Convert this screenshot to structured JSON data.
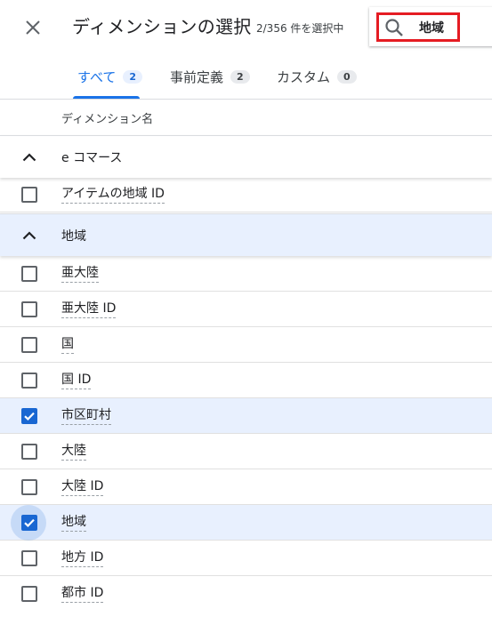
{
  "dialog": {
    "title": "ディメンションの選択",
    "selection_count": "2/356 件を選択中"
  },
  "search": {
    "value": "地域"
  },
  "tabs": [
    {
      "label": "すべて",
      "count": "2",
      "active": true
    },
    {
      "label": "事前定義",
      "count": "2",
      "active": false
    },
    {
      "label": "カスタム",
      "count": "0",
      "active": false
    }
  ],
  "column_header": "ディメンション名",
  "groups": [
    {
      "label": "e コマース",
      "expanded": true,
      "selected": false
    },
    {
      "label": "地域",
      "expanded": true,
      "selected": true
    }
  ],
  "ecommerce_items": [
    {
      "label": "アイテムの地域 ID",
      "checked": false
    }
  ],
  "region_items": [
    {
      "label": "亜大陸",
      "checked": false
    },
    {
      "label": "亜大陸 ID",
      "checked": false
    },
    {
      "label": "国",
      "checked": false
    },
    {
      "label": "国 ID",
      "checked": false
    },
    {
      "label": "市区町村",
      "checked": true
    },
    {
      "label": "大陸",
      "checked": false
    },
    {
      "label": "大陸 ID",
      "checked": false
    },
    {
      "label": "地域",
      "checked": true
    },
    {
      "label": "地方 ID",
      "checked": false
    },
    {
      "label": "都市 ID",
      "checked": false
    }
  ],
  "colors": {
    "accent": "#1a73e8",
    "checkbox_checked": "#1967d2",
    "selected_row": "#e8f0fe",
    "highlight_box": "#e51c23"
  },
  "icons": {
    "close": "close-icon",
    "search": "search-icon",
    "collapse": "chevron-up-icon",
    "check": "check-icon"
  }
}
